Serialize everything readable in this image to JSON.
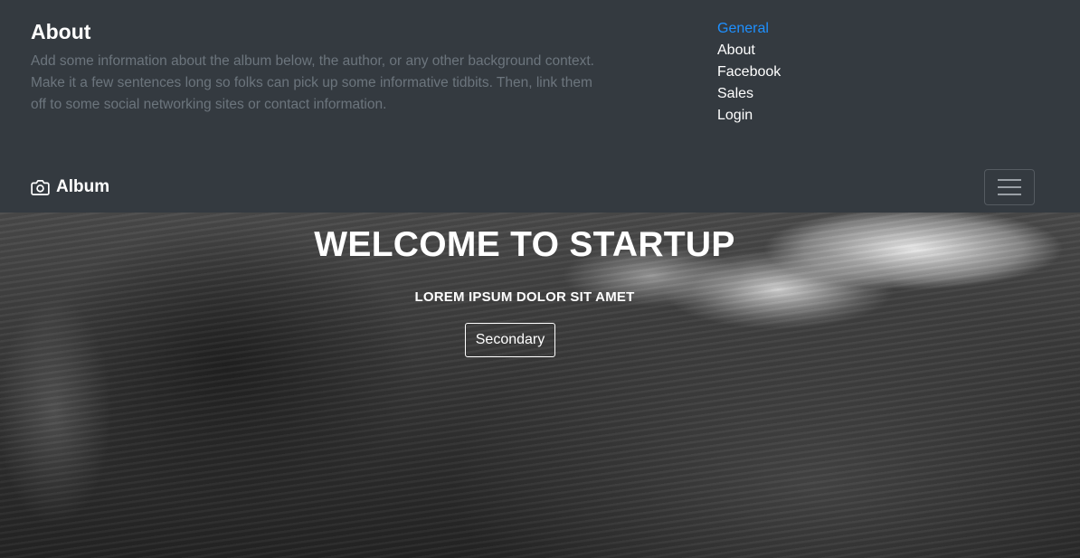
{
  "about": {
    "title": "About",
    "text": "Add some information about the album below, the author, or any other background context. Make it a few sentences long so folks can pick up some informative tidbits. Then, link them off to some social networking sites or contact information."
  },
  "links": [
    {
      "label": "General",
      "active": true
    },
    {
      "label": "About"
    },
    {
      "label": "Facebook"
    },
    {
      "label": "Sales"
    },
    {
      "label": "Login"
    }
  ],
  "navbar": {
    "brand": "Album",
    "brand_icon": "camera-icon",
    "toggler_icon": "hamburger-icon"
  },
  "hero": {
    "title": "WELCOME TO STARTUP",
    "subtitle": "LOREM IPSUM DOLOR SIT AMET",
    "button": "Secondary"
  },
  "colors": {
    "header_bg": "#343a40",
    "muted_text": "#6c757d",
    "active_link": "#1e90ff"
  }
}
